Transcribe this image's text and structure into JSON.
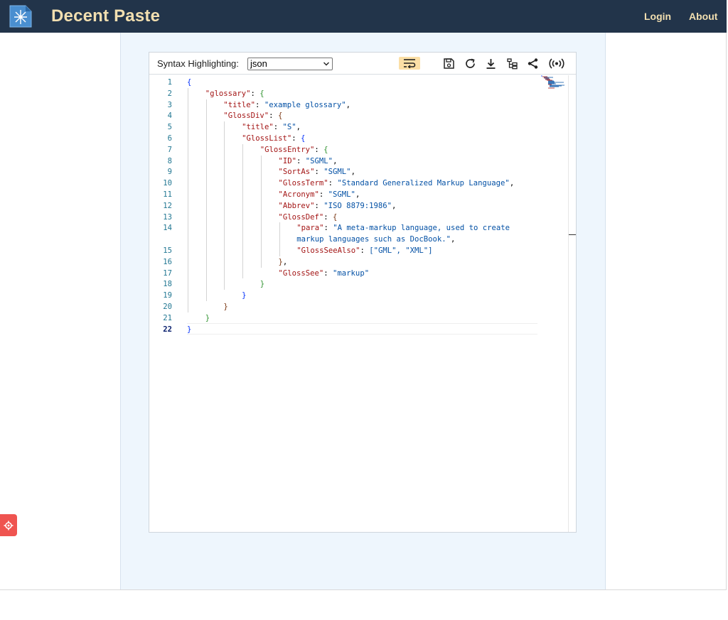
{
  "app": {
    "title": "Decent Paste",
    "logo_icon": "snowflake-network-icon",
    "colors": {
      "navbar": "#22344a",
      "brand_text": "#f2dfb0",
      "page_bg": "#eef6fd",
      "fab": "#ef5450"
    }
  },
  "nav": {
    "login": "Login",
    "about": "About"
  },
  "toolbar": {
    "syntax_label": "Syntax Highlighting:",
    "syntax_value": "json",
    "buttons": [
      {
        "icon": "wrap-text-icon",
        "active": true
      },
      {
        "icon": "save-icon",
        "active": false
      },
      {
        "icon": "refresh-icon",
        "active": false
      },
      {
        "icon": "download-icon",
        "active": false
      },
      {
        "icon": "tree-view-icon",
        "active": false
      },
      {
        "icon": "share-icon",
        "active": false
      },
      {
        "icon": "broadcast-icon",
        "active": false
      }
    ]
  },
  "editor": {
    "current_line": 22,
    "lines": [
      {
        "n": "1",
        "segs": [
          [
            "b1",
            "{"
          ]
        ]
      },
      {
        "n": "2",
        "segs": [
          [
            "key",
            "\"glossary\""
          ],
          [
            "p",
            ": "
          ],
          [
            "b2",
            "{"
          ]
        ]
      },
      {
        "n": "3",
        "segs": [
          [
            "key",
            "\"title\""
          ],
          [
            "p",
            ": "
          ],
          [
            "str",
            "\"example glossary\""
          ],
          [
            "p",
            ","
          ]
        ]
      },
      {
        "n": "4",
        "segs": [
          [
            "key",
            "\"GlossDiv\""
          ],
          [
            "p",
            ": "
          ],
          [
            "b3",
            "{"
          ]
        ]
      },
      {
        "n": "5",
        "segs": [
          [
            "key",
            "\"title\""
          ],
          [
            "p",
            ": "
          ],
          [
            "str",
            "\"S\""
          ],
          [
            "p",
            ","
          ]
        ]
      },
      {
        "n": "6",
        "segs": [
          [
            "key",
            "\"GlossList\""
          ],
          [
            "p",
            ": "
          ],
          [
            "b1",
            "{"
          ]
        ]
      },
      {
        "n": "7",
        "segs": [
          [
            "key",
            "\"GlossEntry\""
          ],
          [
            "p",
            ": "
          ],
          [
            "b2",
            "{"
          ]
        ]
      },
      {
        "n": "8",
        "segs": [
          [
            "key",
            "\"ID\""
          ],
          [
            "p",
            ": "
          ],
          [
            "str",
            "\"SGML\""
          ],
          [
            "p",
            ","
          ]
        ]
      },
      {
        "n": "9",
        "segs": [
          [
            "key",
            "\"SortAs\""
          ],
          [
            "p",
            ": "
          ],
          [
            "str",
            "\"SGML\""
          ],
          [
            "p",
            ","
          ]
        ]
      },
      {
        "n": "10",
        "segs": [
          [
            "key",
            "\"GlossTerm\""
          ],
          [
            "p",
            ": "
          ],
          [
            "str",
            "\"Standard Generalized Markup Language\""
          ],
          [
            "p",
            ","
          ]
        ]
      },
      {
        "n": "11",
        "segs": [
          [
            "key",
            "\"Acronym\""
          ],
          [
            "p",
            ": "
          ],
          [
            "str",
            "\"SGML\""
          ],
          [
            "p",
            ","
          ]
        ]
      },
      {
        "n": "12",
        "segs": [
          [
            "key",
            "\"Abbrev\""
          ],
          [
            "p",
            ": "
          ],
          [
            "str",
            "\"ISO 8879:1986\""
          ],
          [
            "p",
            ","
          ]
        ]
      },
      {
        "n": "13",
        "segs": [
          [
            "key",
            "\"GlossDef\""
          ],
          [
            "p",
            ": "
          ],
          [
            "b3",
            "{"
          ]
        ]
      },
      {
        "n": "14",
        "segs": [
          [
            "key",
            "\"para\""
          ],
          [
            "p",
            ": "
          ],
          [
            "str",
            "\"A meta-markup language, used to create"
          ]
        ]
      },
      {
        "n": "",
        "segs": [
          [
            "str",
            "markup languages such as DocBook.\""
          ],
          [
            "p",
            ","
          ]
        ]
      },
      {
        "n": "15",
        "segs": [
          [
            "key",
            "\"GlossSeeAlso\""
          ],
          [
            "p",
            ": "
          ],
          [
            "str",
            "[\"GML\", \"XML\"]"
          ]
        ]
      },
      {
        "n": "16",
        "segs": [
          [
            "b3",
            "}"
          ],
          [
            "p",
            ","
          ]
        ]
      },
      {
        "n": "17",
        "segs": [
          [
            "key",
            "\"GlossSee\""
          ],
          [
            "p",
            ": "
          ],
          [
            "str",
            "\"markup\""
          ]
        ]
      },
      {
        "n": "18",
        "segs": [
          [
            "b2",
            "}"
          ]
        ]
      },
      {
        "n": "19",
        "segs": [
          [
            "b1",
            "}"
          ]
        ]
      },
      {
        "n": "20",
        "segs": [
          [
            "b3",
            "}"
          ]
        ]
      },
      {
        "n": "21",
        "segs": [
          [
            "b2",
            "}"
          ]
        ]
      },
      {
        "n": "22",
        "segs": [
          [
            "b1",
            "}"
          ]
        ]
      }
    ]
  },
  "fab": {
    "icon": "settings-gear-icon"
  }
}
